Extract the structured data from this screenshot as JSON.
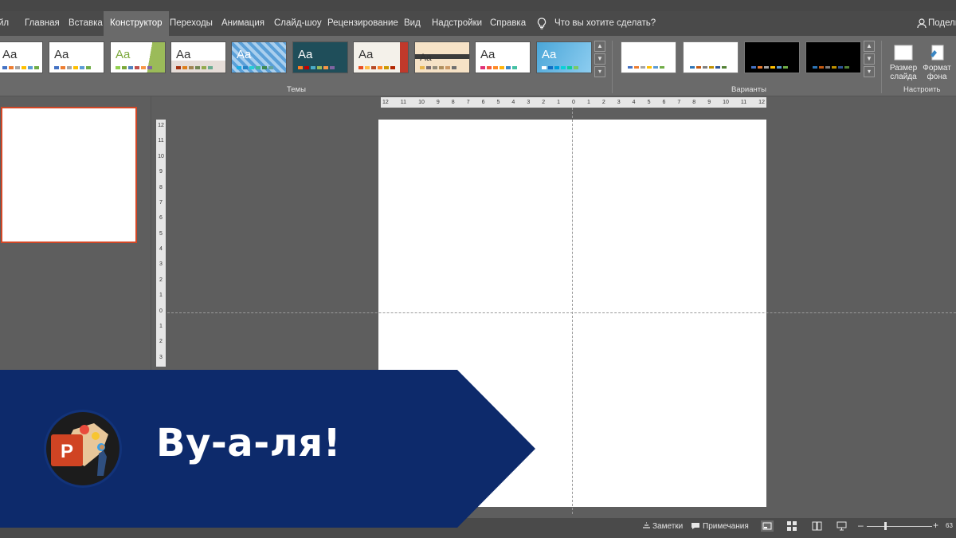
{
  "ribbon_tabs": [
    "йл",
    "Главная",
    "Вставка",
    "Конструктор",
    "Переходы",
    "Анимация",
    "Слайд-шоу",
    "Рецензирование",
    "Вид",
    "Надстройки",
    "Справка"
  ],
  "tell_me": "Что вы хотите сделать?",
  "share": "Подели",
  "theme_sample": "Aa",
  "groups": {
    "themes": "Темы",
    "variants": "Варианты",
    "customize": "Настроить"
  },
  "customize": {
    "slide_size": "Размер слайда",
    "format_bg": "Формат фона"
  },
  "hruler_ticks": [
    "12",
    "11",
    "10",
    "9",
    "8",
    "7",
    "6",
    "5",
    "4",
    "3",
    "2",
    "1",
    "0",
    "1",
    "2",
    "3",
    "4",
    "5",
    "6",
    "7",
    "8",
    "9",
    "10",
    "11",
    "12"
  ],
  "vruler_ticks": [
    "12",
    "11",
    "10",
    "9",
    "8",
    "7",
    "6",
    "5",
    "4",
    "3",
    "2",
    "1",
    "0",
    "1",
    "2",
    "3"
  ],
  "status": {
    "notes": "Заметки",
    "comments": "Примечания",
    "zoom": "63"
  },
  "banner": {
    "text": "Ву-а-ля!",
    "color": "#0d2a6b"
  },
  "accent": "#d24726"
}
